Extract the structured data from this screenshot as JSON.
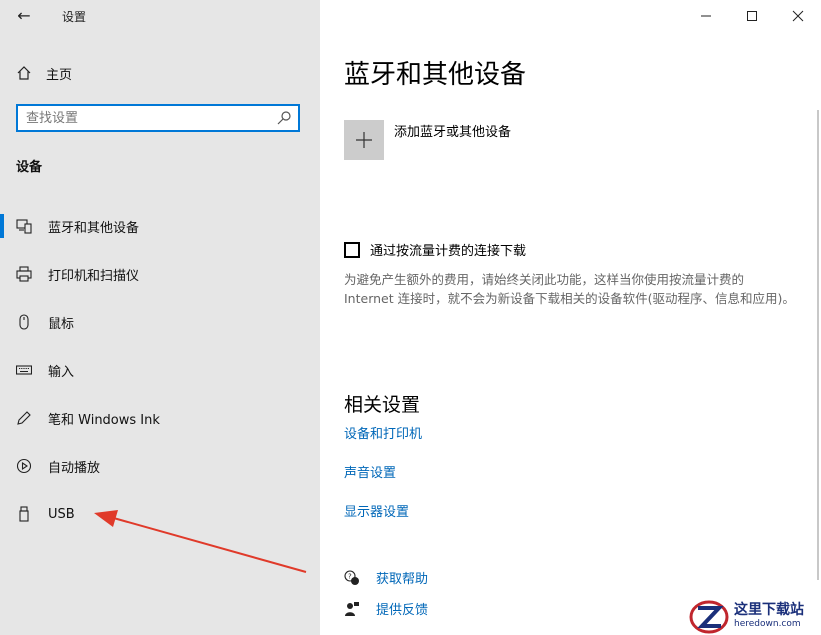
{
  "window": {
    "title": "设置",
    "back_icon": "arrow-left-icon",
    "controls": [
      "minimize-icon",
      "maximize-icon",
      "close-icon"
    ]
  },
  "sidebar": {
    "home_label": "主页",
    "search_placeholder": "查找设置",
    "section_title": "设备",
    "items": [
      {
        "label": "蓝牙和其他设备",
        "icon": "bluetooth-devices-icon",
        "selected": true
      },
      {
        "label": "打印机和扫描仪",
        "icon": "printer-icon",
        "selected": false
      },
      {
        "label": "鼠标",
        "icon": "mouse-icon",
        "selected": false
      },
      {
        "label": "输入",
        "icon": "keyboard-icon",
        "selected": false
      },
      {
        "label": "笔和 Windows Ink",
        "icon": "pen-icon",
        "selected": false
      },
      {
        "label": "自动播放",
        "icon": "autoplay-icon",
        "selected": false
      },
      {
        "label": "USB",
        "icon": "usb-icon",
        "selected": false
      }
    ]
  },
  "main": {
    "page_title": "蓝牙和其他设备",
    "add_device_label": "添加蓝牙或其他设备",
    "metered_checkbox_label": "通过按流量计费的连接下载",
    "metered_checked": false,
    "metered_description": "为避免产生额外的费用，请始终关闭此功能，这样当你使用按流量计费的 Internet 连接时，就不会为新设备下载相关的设备软件(驱动程序、信息和应用)。",
    "related_title": "相关设置",
    "related_links": [
      "设备和打印机",
      "声音设置",
      "显示器设置"
    ],
    "help_label": "获取帮助",
    "feedback_label": "提供反馈"
  },
  "watermark": {
    "main": "这里下载站",
    "sub": "heredown.com"
  },
  "colors": {
    "accent": "#0078d7",
    "link": "#0067b8",
    "sidebar_bg": "#e6e6e6",
    "annotation_arrow": "#e03a2a"
  }
}
